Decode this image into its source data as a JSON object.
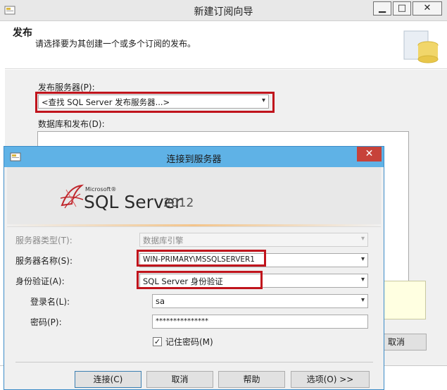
{
  "wizard": {
    "title": "新建订阅向导",
    "heading": "发布",
    "subheading": "请选择要为其创建一个或多个订阅的发布。",
    "publisher_label": "发布服务器(P):",
    "publisher_value": "<查找 SQL Server 发布服务器...>",
    "databases_label": "数据库和发布(D):",
    "cancel_partial": "取消",
    "window_buttons": [
      "minimize-icon",
      "maximize-icon",
      "close-icon"
    ]
  },
  "dialog": {
    "title": "连接到服务器",
    "logo": {
      "brand": "Microsoft®",
      "product": "SQL Server",
      "year": "2012"
    },
    "server_type_label": "服务器类型(T):",
    "server_type_value": "数据库引擎",
    "server_name_label": "服务器名称(S):",
    "server_name_value": "WIN-PRIMARY\\MSSQLSERVER1",
    "auth_label": "身份验证(A):",
    "auth_value": "SQL Server 身份验证",
    "login_label": "登录名(L):",
    "login_value": "sa",
    "password_label": "密码(P):",
    "password_value": "***************",
    "remember_label": "记住密码(M)",
    "remember_checked": true,
    "buttons": {
      "connect": "连接(C)",
      "cancel": "取消",
      "help": "帮助",
      "options": "选项(O) >>"
    }
  },
  "colors": {
    "highlight_red": "#c0141c",
    "dialog_title_bar": "#5fb2e6",
    "close_red": "#c7423a"
  }
}
